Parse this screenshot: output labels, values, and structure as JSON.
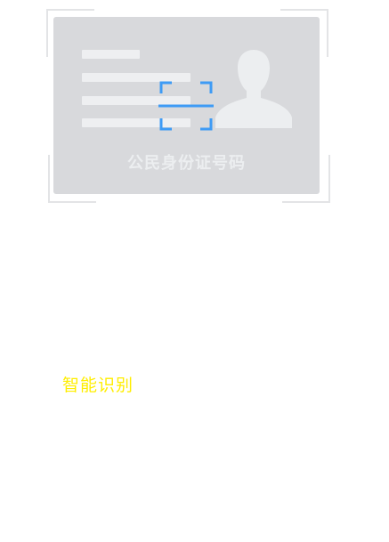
{
  "card": {
    "caption": "公民身份证号码"
  },
  "label": {
    "smart_recognition": "智能识别"
  },
  "colors": {
    "card_background": "#d8d9dc",
    "scan_accent": "#3e9bf5",
    "label_text": "#ffee00"
  },
  "icons": {
    "avatar": "person-silhouette-icon",
    "scan": "scan-frame-icon"
  }
}
